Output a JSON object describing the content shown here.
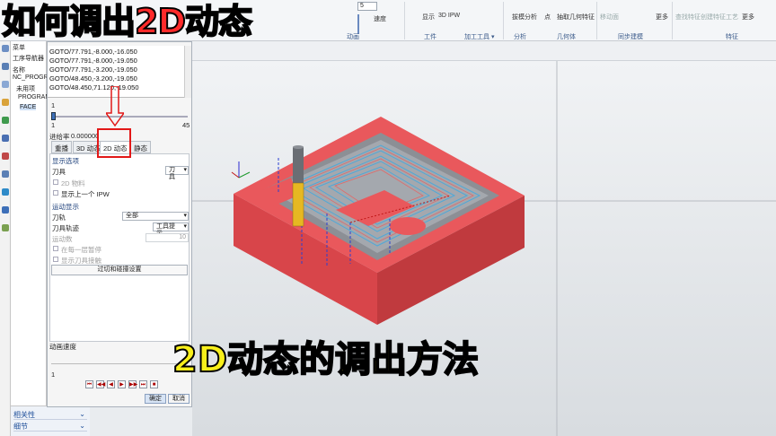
{
  "overlay": {
    "title": "如何调出2D动态",
    "subtitle": "2D动态的调出方法"
  },
  "ribbon": {
    "spin_value": "5",
    "items": {
      "speed": "速度",
      "display": "显示",
      "ipw3d": "3D IPW",
      "animation_group": "动画",
      "tool_group": "工件",
      "machining_tools": "加工工具 ▾",
      "draft_analysis": "拔模分析",
      "analysis_group": "分析",
      "point": "点",
      "extract_geometry": "抽取几何特征",
      "geometry_group": "几何体",
      "move_face": "移动面",
      "sync_group": "同步建模",
      "more1": "更多",
      "find_feature": "查找特征",
      "create_process_feature": "创建特征工艺",
      "feature_group": "特征",
      "more2": "更多"
    }
  },
  "navigator": {
    "menu": "菜单",
    "title": "工序导航器",
    "col_name": "名称",
    "program_root": "NC_PROGRAM",
    "unused": "未用项",
    "program": "PROGRAM",
    "operation": "FACE",
    "footer": [
      "相关性",
      "细节"
    ]
  },
  "dialog": {
    "gcode": [
      "GOTO/77.791,-8.000,-16.050",
      "GOTO/77.791,-8.000,-19.050",
      "GOTO/77.791,-3.200,-19.050",
      "GOTO/48.450,-3.200,-19.050",
      "GOTO/48.450,71.120,-19.050"
    ],
    "slider_top_value": "1",
    "slider_min": "1",
    "slider_max": "45",
    "feed_rate_label": "进给率",
    "feed_rate_value": "0.000000",
    "tabs": [
      "重播",
      "3D 动态",
      "2D 动态",
      "静态"
    ],
    "active_tab": "2D 动态",
    "display_options": "显示选项",
    "tool_label": "刀具",
    "tool_value": "刀具",
    "cb_2d_material": "2D 物料",
    "cb_show_prev_ipw": "显示上一个 IPW",
    "motion_display": "运动显示",
    "motion_label": "刀轨",
    "motion_value": "全部",
    "toolpath_label": "刀具轨迹",
    "toolpath_value": "工具提示",
    "motion_count_label": "运动数",
    "motion_count_value": "10",
    "cb_pause_each": "在每一层暂停",
    "cb_show_contact": "显示刀具接触",
    "collision_button": "过切和碰撞设置",
    "anim_speed_label": "动画速度",
    "anim_speed_value": "1",
    "player": [
      "⏮",
      "◀◀",
      "◀",
      "▶",
      "▶▶",
      "⏭",
      "■"
    ],
    "ok": "确定",
    "cancel": "取消"
  },
  "colors": {
    "part": "#e9585c",
    "part_dark": "#b83438",
    "toolpath": "#4fa8d8",
    "title_red": "#ff2a2a",
    "subtitle_yellow": "#f8ef1a"
  }
}
